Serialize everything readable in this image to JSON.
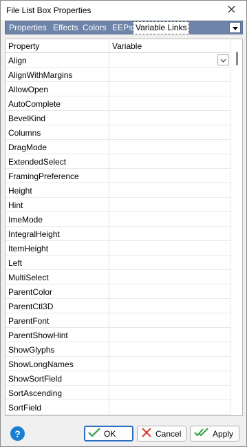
{
  "window": {
    "title": "File List Box Properties"
  },
  "tabs": [
    {
      "label": "Properties",
      "active": false
    },
    {
      "label": "Effects",
      "active": false
    },
    {
      "label": "Colors",
      "active": false
    },
    {
      "label": "EEPs",
      "active": false
    },
    {
      "label": "Variable Links",
      "active": true
    }
  ],
  "grid": {
    "columns": [
      "Property",
      "Variable"
    ],
    "rows": [
      {
        "property": "Align",
        "variable": "",
        "has_combo": true
      },
      {
        "property": "AlignWithMargins",
        "variable": ""
      },
      {
        "property": "AllowOpen",
        "variable": ""
      },
      {
        "property": "AutoComplete",
        "variable": ""
      },
      {
        "property": "BevelKind",
        "variable": ""
      },
      {
        "property": "Columns",
        "variable": ""
      },
      {
        "property": "DragMode",
        "variable": ""
      },
      {
        "property": "ExtendedSelect",
        "variable": ""
      },
      {
        "property": "FramingPreference",
        "variable": ""
      },
      {
        "property": "Height",
        "variable": ""
      },
      {
        "property": "Hint",
        "variable": ""
      },
      {
        "property": "ImeMode",
        "variable": ""
      },
      {
        "property": "IntegralHeight",
        "variable": ""
      },
      {
        "property": "ItemHeight",
        "variable": ""
      },
      {
        "property": "Left",
        "variable": ""
      },
      {
        "property": "MultiSelect",
        "variable": ""
      },
      {
        "property": "ParentColor",
        "variable": ""
      },
      {
        "property": "ParentCtl3D",
        "variable": ""
      },
      {
        "property": "ParentFont",
        "variable": ""
      },
      {
        "property": "ParentShowHint",
        "variable": ""
      },
      {
        "property": "ShowGlyphs",
        "variable": ""
      },
      {
        "property": "ShowLongNames",
        "variable": ""
      },
      {
        "property": "ShowSortField",
        "variable": ""
      },
      {
        "property": "SortAscending",
        "variable": ""
      },
      {
        "property": "SortField",
        "variable": ""
      }
    ]
  },
  "buttons": {
    "ok": "OK",
    "cancel": "Cancel",
    "apply": "Apply"
  },
  "icons": {
    "help": "help-icon",
    "close": "close-icon",
    "ok": "checkmark-icon",
    "cancel": "x-icon",
    "apply": "double-checkmark-icon"
  },
  "colors": {
    "tabstrip": "#6e84a8",
    "help": "#1a7fd1",
    "ok_check": "#2e9e3e",
    "cancel_x": "#d63a2e"
  }
}
